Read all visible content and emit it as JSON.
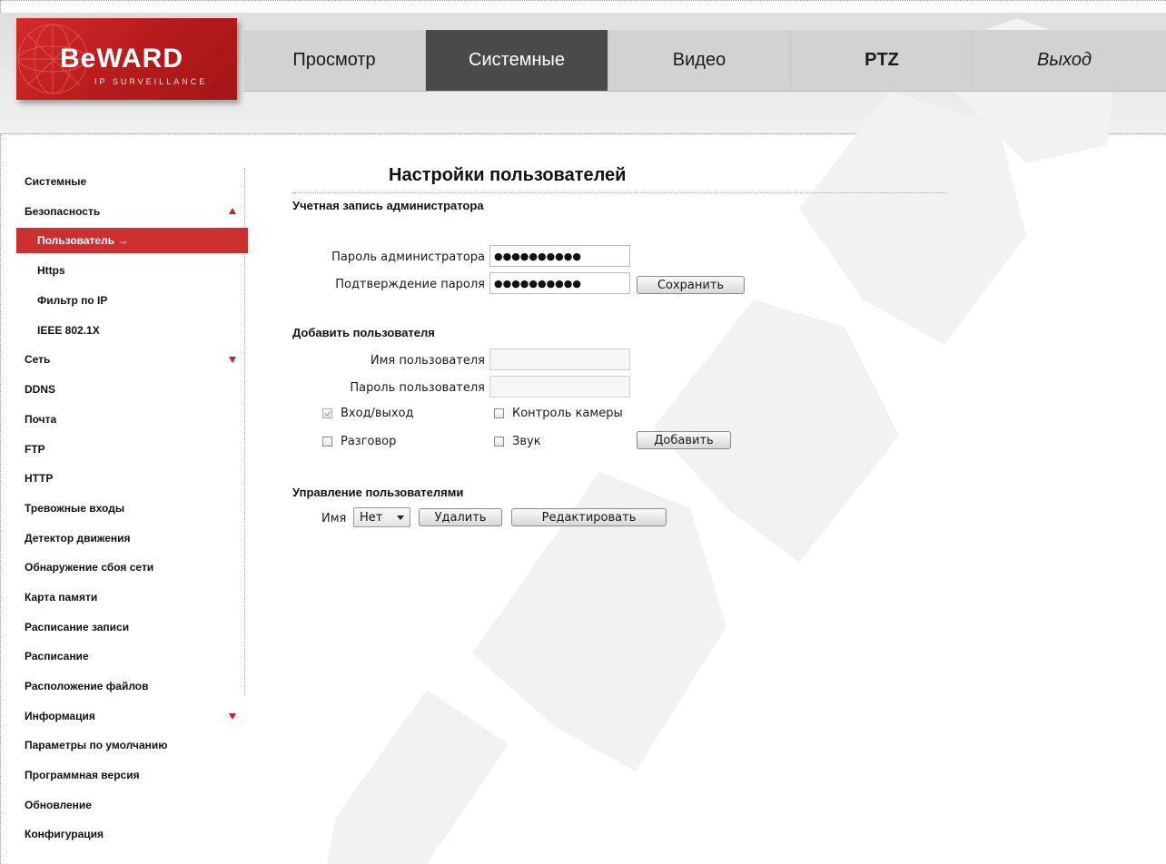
{
  "brand": {
    "logo_text": "BeWARD",
    "logo_sub": "IP SURVEILLANCE"
  },
  "nav": {
    "items": [
      {
        "label": "Просмотр"
      },
      {
        "label": "Системные"
      },
      {
        "label": "Видео"
      },
      {
        "label": "PTZ"
      },
      {
        "label": "Выход"
      }
    ],
    "active": "Системные"
  },
  "sidebar": {
    "items": [
      {
        "label": "Системные"
      },
      {
        "label": "Безопасность"
      },
      {
        "label": "Пользователь →"
      },
      {
        "label": "Https"
      },
      {
        "label": "Фильтр по IP"
      },
      {
        "label": "IEEE 802.1X"
      },
      {
        "label": "Сеть"
      },
      {
        "label": "DDNS"
      },
      {
        "label": "Почта"
      },
      {
        "label": "FTP"
      },
      {
        "label": "HTTP"
      },
      {
        "label": "Тревожные входы"
      },
      {
        "label": "Детектор движения"
      },
      {
        "label": "Обнаружение сбоя сети"
      },
      {
        "label": "Карта памяти"
      },
      {
        "label": "Расписание записи"
      },
      {
        "label": "Расписание"
      },
      {
        "label": "Расположение файлов"
      },
      {
        "label": "Информация"
      },
      {
        "label": "Параметры по умолчанию"
      },
      {
        "label": "Программная версия"
      },
      {
        "label": "Обновление"
      },
      {
        "label": "Конфигурация"
      }
    ],
    "active": "Пользователь",
    "accent_color": "#cc2f2f"
  },
  "page": {
    "title": "Настройки пользователей"
  },
  "admin": {
    "section_title": "Учетная запись администратора",
    "password_label": "Пароль администратора",
    "password_value": "●●●●●●●●●●",
    "confirm_label": "Подтверждение пароля",
    "confirm_value": "●●●●●●●●●●",
    "save_label": "Сохранить"
  },
  "add_user": {
    "section_title": "Добавить пользователя",
    "username_label": "Имя пользователя",
    "password_label": "Пароль пользователя",
    "checkboxes": [
      {
        "label": "Вход/выход",
        "checked": true,
        "disabled": true
      },
      {
        "label": "Контроль камеры",
        "checked": false
      },
      {
        "label": "Разговор",
        "checked": false
      },
      {
        "label": "Звук",
        "checked": false
      }
    ],
    "add_label": "Добавить"
  },
  "manage": {
    "section_title": "Управление пользователями",
    "name_label": "Имя",
    "select_value": "Нет",
    "delete_label": "Удалить",
    "edit_label": "Редактировать"
  }
}
